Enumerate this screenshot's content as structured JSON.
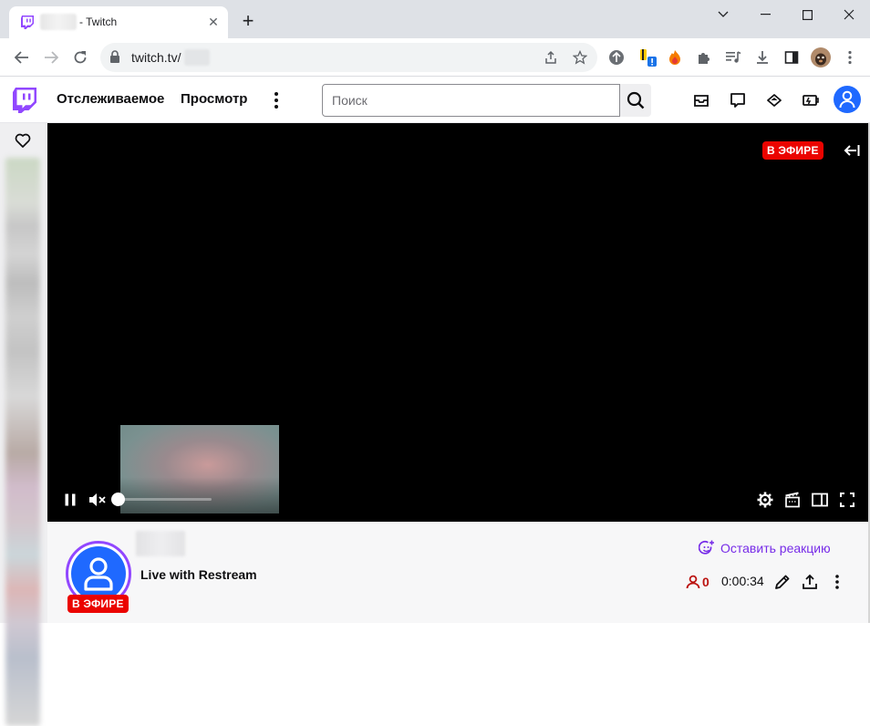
{
  "browser": {
    "tab": {
      "title": "- Twitch",
      "close_glyph": "✕"
    },
    "new_tab_glyph": "+",
    "address": {
      "url": "twitch.tv/"
    },
    "window_controls": [
      "minimize",
      "maximize",
      "close"
    ]
  },
  "twitch_nav": {
    "links": {
      "following": "Отслеживаемое",
      "browse": "Просмотр"
    },
    "search": {
      "placeholder": "Поиск"
    },
    "icons": [
      "inbox-icon",
      "whispers-icon",
      "prime-crown-icon",
      "bits-icon",
      "user-avatar-icon"
    ]
  },
  "player": {
    "live_badge": "В ЭФИРЕ",
    "volume_level": 0,
    "muted": true,
    "controls": [
      "pause-icon",
      "mute-icon",
      "settings-icon",
      "clip-icon",
      "theatre-mode-icon",
      "fullscreen-icon"
    ]
  },
  "channel_info": {
    "live_badge": "В ЭФИРЕ",
    "stream_title": "Live with Restream",
    "react_label": "Оставить реакцию",
    "viewer_count": "0",
    "uptime": "0:00:34"
  },
  "colors": {
    "twitch_purple": "#9147ff",
    "live_red": "#eb0400",
    "avatar_blue": "#1f69ff",
    "viewer_red": "#bb1411"
  }
}
